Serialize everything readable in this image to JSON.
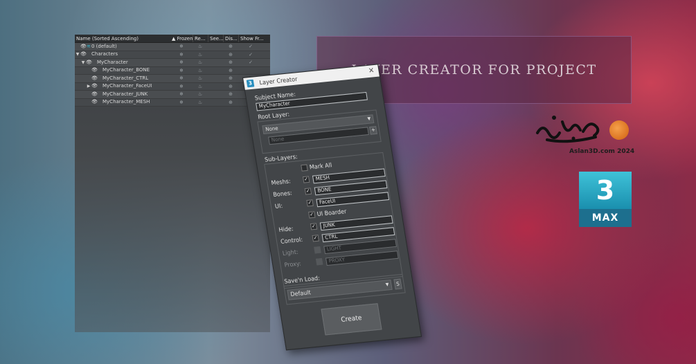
{
  "explorer": {
    "columns": {
      "name": "Name (Sorted Ascending)",
      "frozen": "▲ Frozen",
      "render": "Re...",
      "see": "See...",
      "display": "Dis...",
      "show": "Show Fr..."
    },
    "rows": [
      {
        "label": "0 (default)"
      },
      {
        "label": "Characters"
      },
      {
        "label": "MyCharacter"
      },
      {
        "label": "MyCharacter_BONE"
      },
      {
        "label": "MyCharacter_CTRL"
      },
      {
        "label": "MyCharacter_FaceUI"
      },
      {
        "label": "MyCharacter_JUNK"
      },
      {
        "label": "MyCharacter_MESH"
      }
    ]
  },
  "banner": {
    "title": "LAYER CREATOR FOR PROJECT"
  },
  "logo": {
    "credit": "Aslan3D.com 2024"
  },
  "max_badge": {
    "number": "3",
    "label": "MAX"
  },
  "dialog": {
    "title": "Layer Creator",
    "subject_name_label": "Subject Name:",
    "subject_name_value": "MyCharacter",
    "root_layer_label": "Root Layer:",
    "root_dropdown_value": "None",
    "root_field_value": "None",
    "root_plus": "+",
    "sub_layers_label": "Sub-Layers:",
    "mark_all_label": "Mark All",
    "meshs_label": "Meshs:",
    "meshs_value": "MESH",
    "bones_label": "Bones:",
    "bones_value": "BONE",
    "ui_label": "UI:",
    "ui_value": "FaceUI",
    "ui_boarder_label": "UI Boarder",
    "hide_label": "Hide:",
    "hide_value": "JUNK",
    "control_label": "Control:",
    "control_value": "CTRL",
    "light_label": "Light:",
    "light_value": "LIGHT",
    "proxy_label": "Proxy:",
    "proxy_value": "PROXY",
    "save_load_label": "Save'n Load:",
    "preset_value": "Default",
    "save_button": "S",
    "create_button": "Create",
    "check_mark": "✓"
  }
}
